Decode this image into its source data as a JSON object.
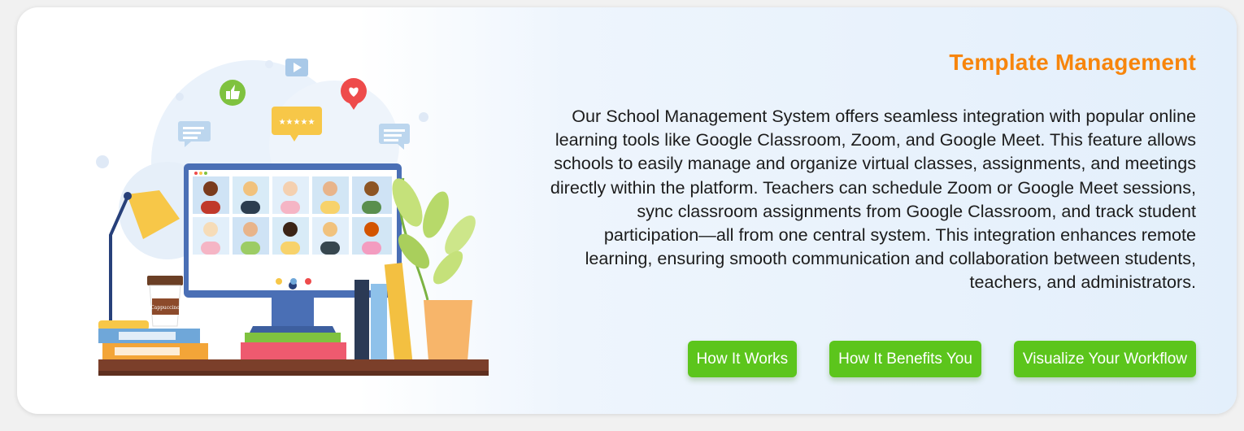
{
  "feature": {
    "title": "Template Management",
    "description": "Our School Management System offers seamless integration with popular online learning tools like Google Classroom, Zoom, and Google Meet. This feature allows schools to easily manage and organize virtual classes, assignments, and meetings directly within the platform. Teachers can schedule Zoom or Google Meet sessions, sync classroom assignments from Google Classroom, and track student participation—all from one central system. This integration enhances remote learning, ensuring smooth communication and collaboration between students, teachers, and administrators."
  },
  "buttons": [
    {
      "label": "How It Works"
    },
    {
      "label": "How It Benefits You"
    },
    {
      "label": "Visualize Your Workflow"
    }
  ],
  "illustration": {
    "cup_label": "Cappuccino",
    "rating_stars": "★★★★★"
  },
  "colors": {
    "title": "#f7850c",
    "button": "#5cc51c",
    "text": "#1c1c1c"
  }
}
